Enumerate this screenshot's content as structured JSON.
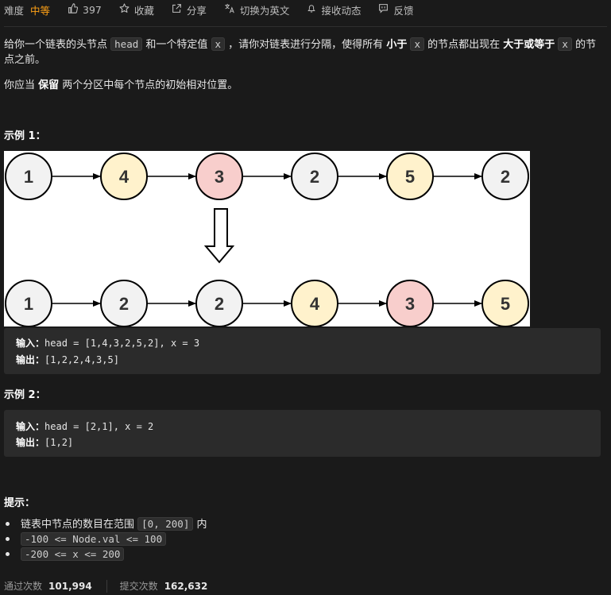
{
  "toolbar": {
    "difficulty_label": "难度",
    "difficulty_value": "中等",
    "likes": "397",
    "favorite": "收藏",
    "share": "分享",
    "translate": "切换为英文",
    "notifications": "接收动态",
    "feedback": "反馈",
    "icons": {
      "likes": "thumbs-up-icon",
      "favorite": "star-icon",
      "share": "share-icon",
      "translate": "translate-icon",
      "notifications": "bell-icon",
      "feedback": "feedback-icon"
    }
  },
  "description": {
    "p1_a": "给你一个链表的头节点 ",
    "p1_code1": "head",
    "p1_b": " 和一个特定值 ",
    "p1_code2": "x",
    "p1_c": " ，请你对链表进行分隔，使得所有 ",
    "p1_bold1": "小于",
    "p1_d": " ",
    "p1_code3": "x",
    "p1_e": " 的节点都出现在 ",
    "p1_bold2": "大于或等于",
    "p1_f": " ",
    "p1_code4": "x",
    "p1_g": " 的节点之前。",
    "p2_a": "你应当 ",
    "p2_bold": "保留",
    "p2_b": " 两个分区中每个节点的初始相对位置。"
  },
  "example1": {
    "title": "示例 1：",
    "diagram": {
      "top_row": [
        "1",
        "4",
        "3",
        "2",
        "5",
        "2"
      ],
      "bottom_row": [
        "1",
        "2",
        "2",
        "4",
        "3",
        "5"
      ],
      "colors": {
        "1": "#f2f2f2",
        "2": "#f2f2f2",
        "4": "#fff2cc",
        "5": "#fff2cc",
        "3": "#f8cecc"
      }
    },
    "input_label": "输入：",
    "input_value": "head = [1,4,3,2,5,2], x = 3",
    "output_label": "输出：",
    "output_value": "[1,2,2,4,3,5]"
  },
  "example2": {
    "title": "示例 2：",
    "input_label": "输入：",
    "input_value": "head = [2,1], x = 2",
    "output_label": "输出：",
    "output_value": "[1,2]"
  },
  "hints": {
    "title": "提示：",
    "h1_text": "链表中节点的数目在范围 ",
    "h1_code": "[0, 200]",
    "h1_tail": " 内",
    "h2_code": "-100 <= Node.val <= 100",
    "h3_code": "-200 <= x <= 200"
  },
  "stats": {
    "accepted_label": "通过次数",
    "accepted_value": "101,994",
    "submissions_label": "提交次数",
    "submissions_value": "162,632"
  }
}
